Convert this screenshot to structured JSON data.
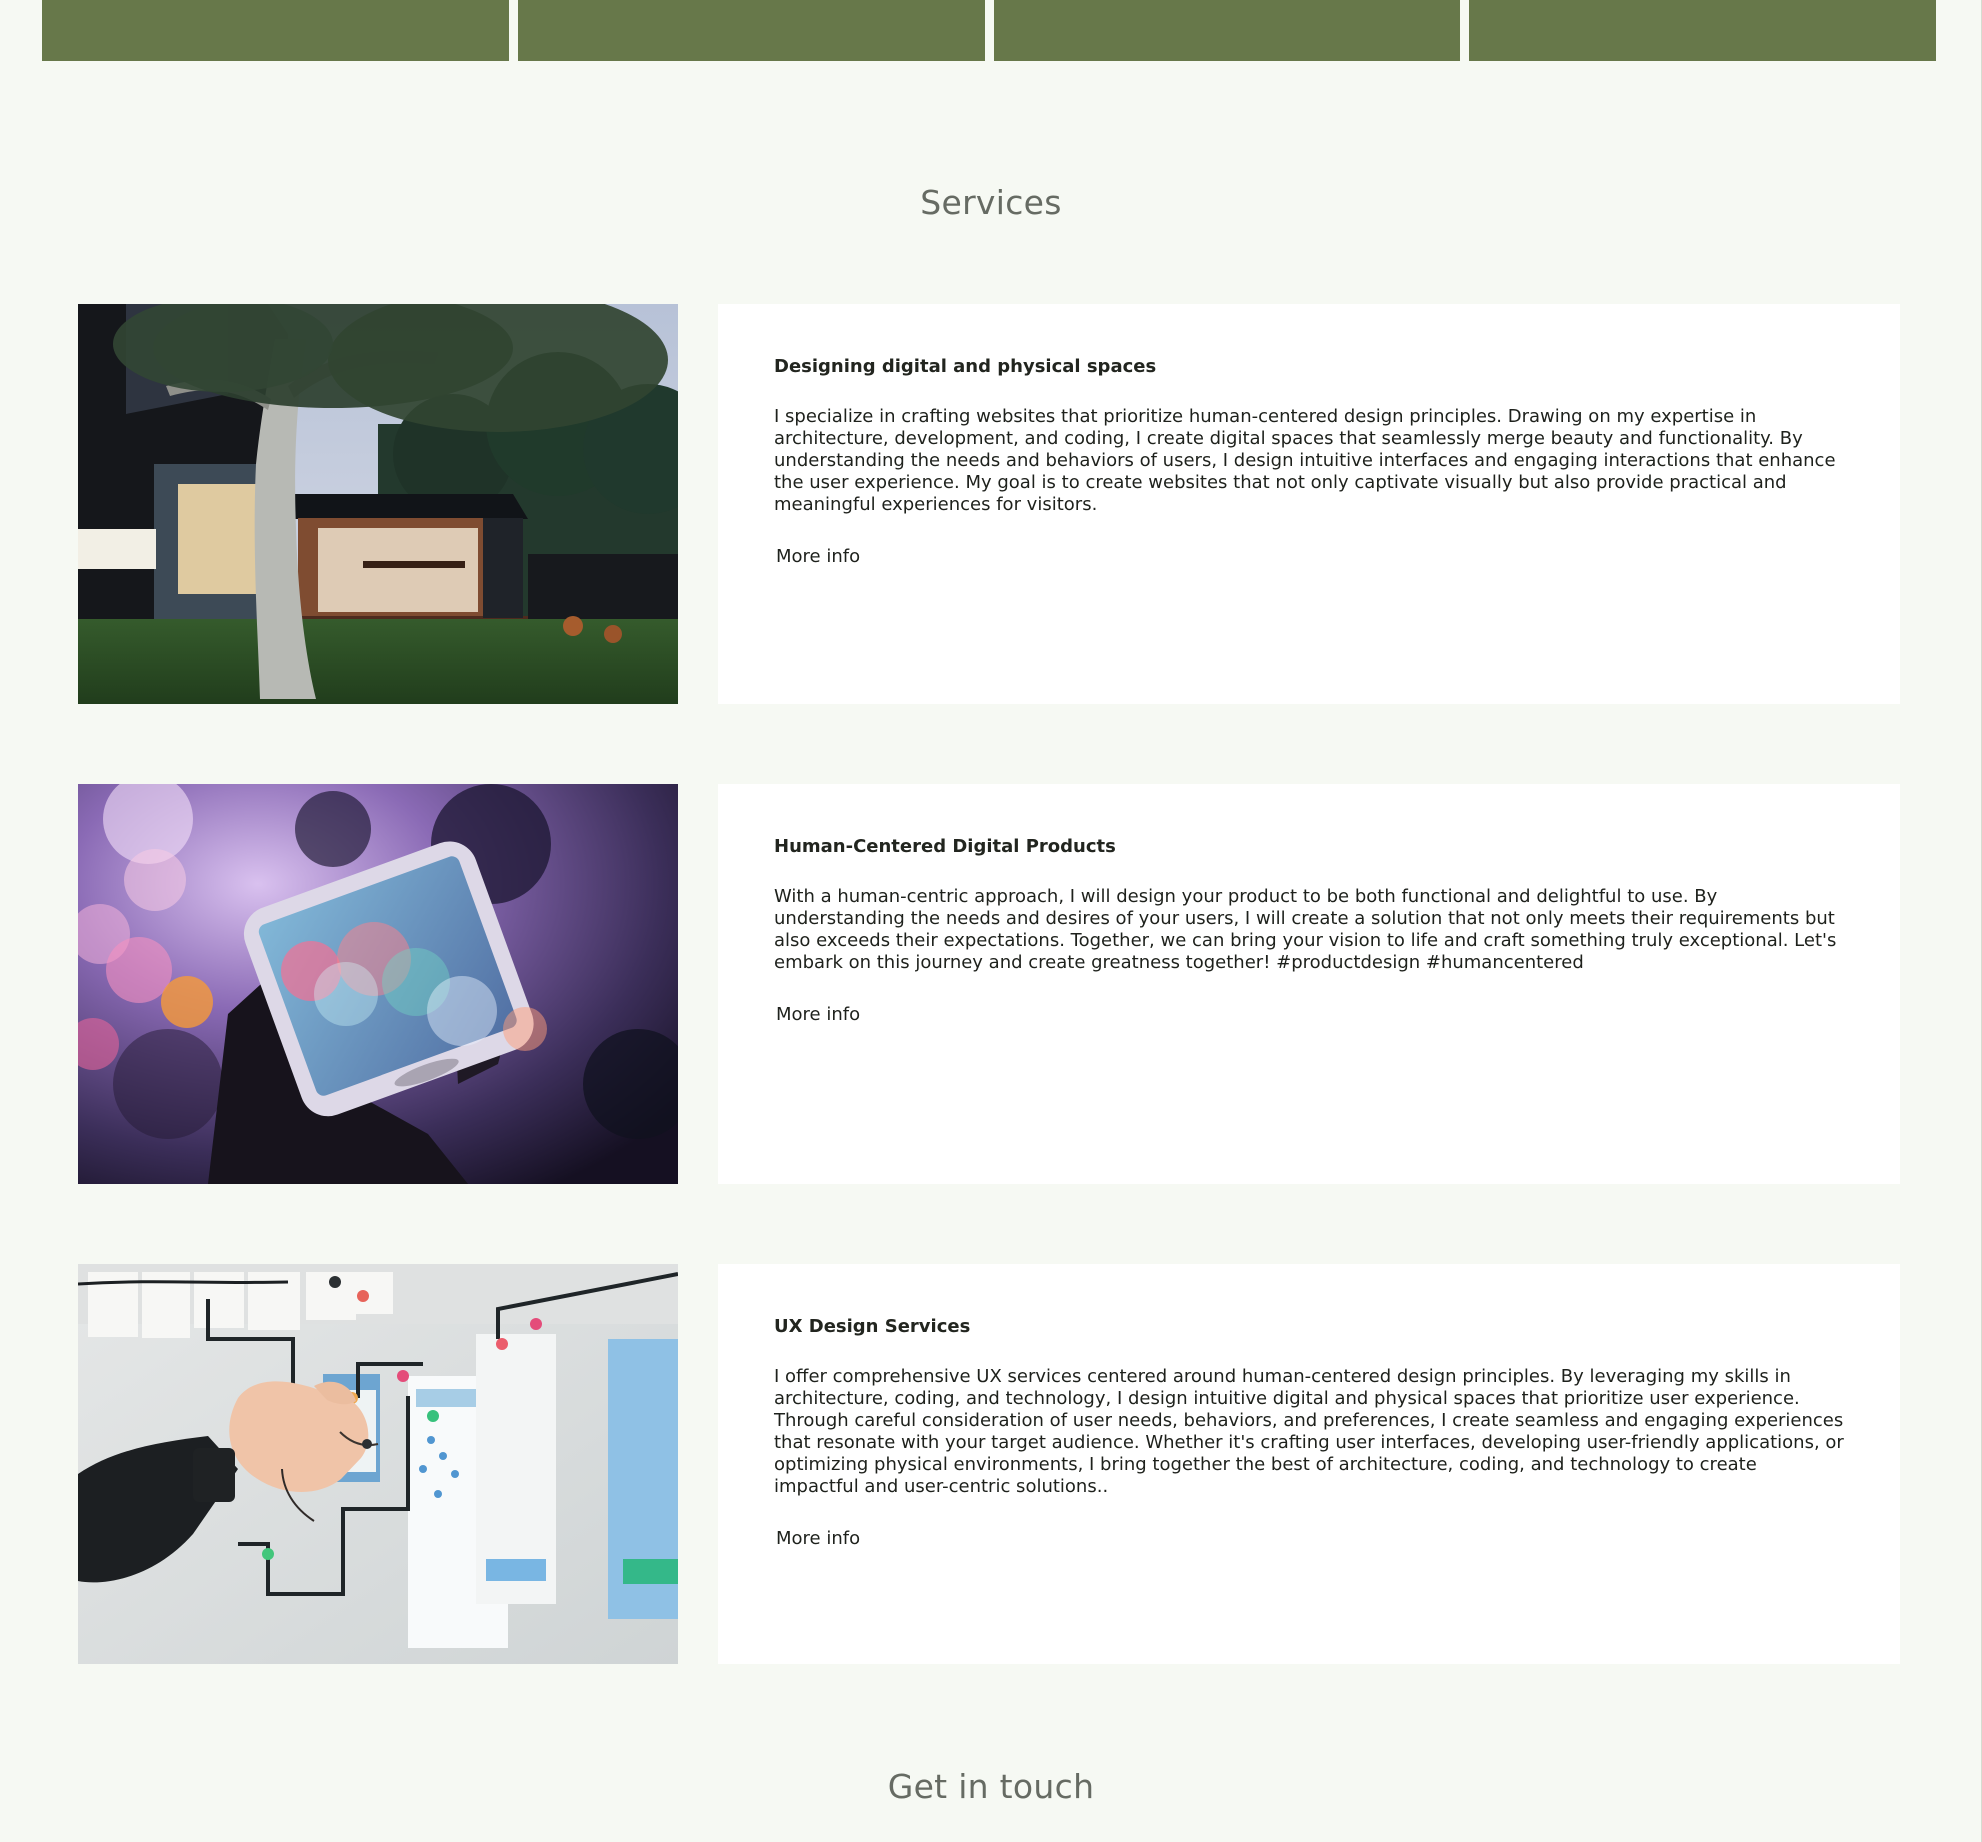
{
  "nav_tiles": [
    {
      "name": "nav-tile-1"
    },
    {
      "name": "nav-tile-2"
    },
    {
      "name": "nav-tile-3"
    },
    {
      "name": "nav-tile-4"
    }
  ],
  "services_section": {
    "title": "Services",
    "items": [
      {
        "image_icon": "modern-house-photo",
        "heading": "Designing digital and physical spaces",
        "body": "I specialize in crafting websites that prioritize human-centered design principles. Drawing on my expertise in architecture, development, and coding, I create digital spaces that seamlessly merge beauty and functionality. By understanding the needs and behaviors of users, I design intuitive interfaces and engaging interactions that enhance the user experience. My goal is to create websites that not only captivate visually but also provide practical and meaningful experiences for visitors.",
        "link_label": "More info"
      },
      {
        "image_icon": "smartphone-bokeh-photo",
        "heading": "Human-Centered Digital Products",
        "body": "With a human-centric approach, I will design your product to be both functional and delightful to use. By understanding the needs and desires of your users, I will create a solution that not only meets their requirements but also exceeds their expectations. Together, we can bring your vision to life and craft something truly exceptional. Let's embark on this journey and create greatness together! #productdesign #humancentered",
        "link_label": "More info"
      },
      {
        "image_icon": "ux-wireframe-board-photo",
        "heading": "UX Design Services",
        "body": "I offer comprehensive UX services centered around human-centered design principles. By leveraging my skills in architecture, coding, and technology, I design intuitive digital and physical spaces that prioritize user experience. Through careful consideration of user needs, behaviors, and preferences, I create seamless and engaging experiences that resonate with your target audience. Whether it's crafting user interfaces, developing user-friendly applications, or optimizing physical environments, I bring together the best of architecture, coding, and technology to create impactful and user-centric solutions..",
        "link_label": "More info"
      }
    ]
  },
  "contact_section": {
    "title": "Get in touch"
  },
  "colors": {
    "page_background": "#f6f9f3",
    "nav_tile": "#67784a",
    "card_background": "#ffffff",
    "section_title": "#666b63",
    "body_text": "#1e211c"
  }
}
